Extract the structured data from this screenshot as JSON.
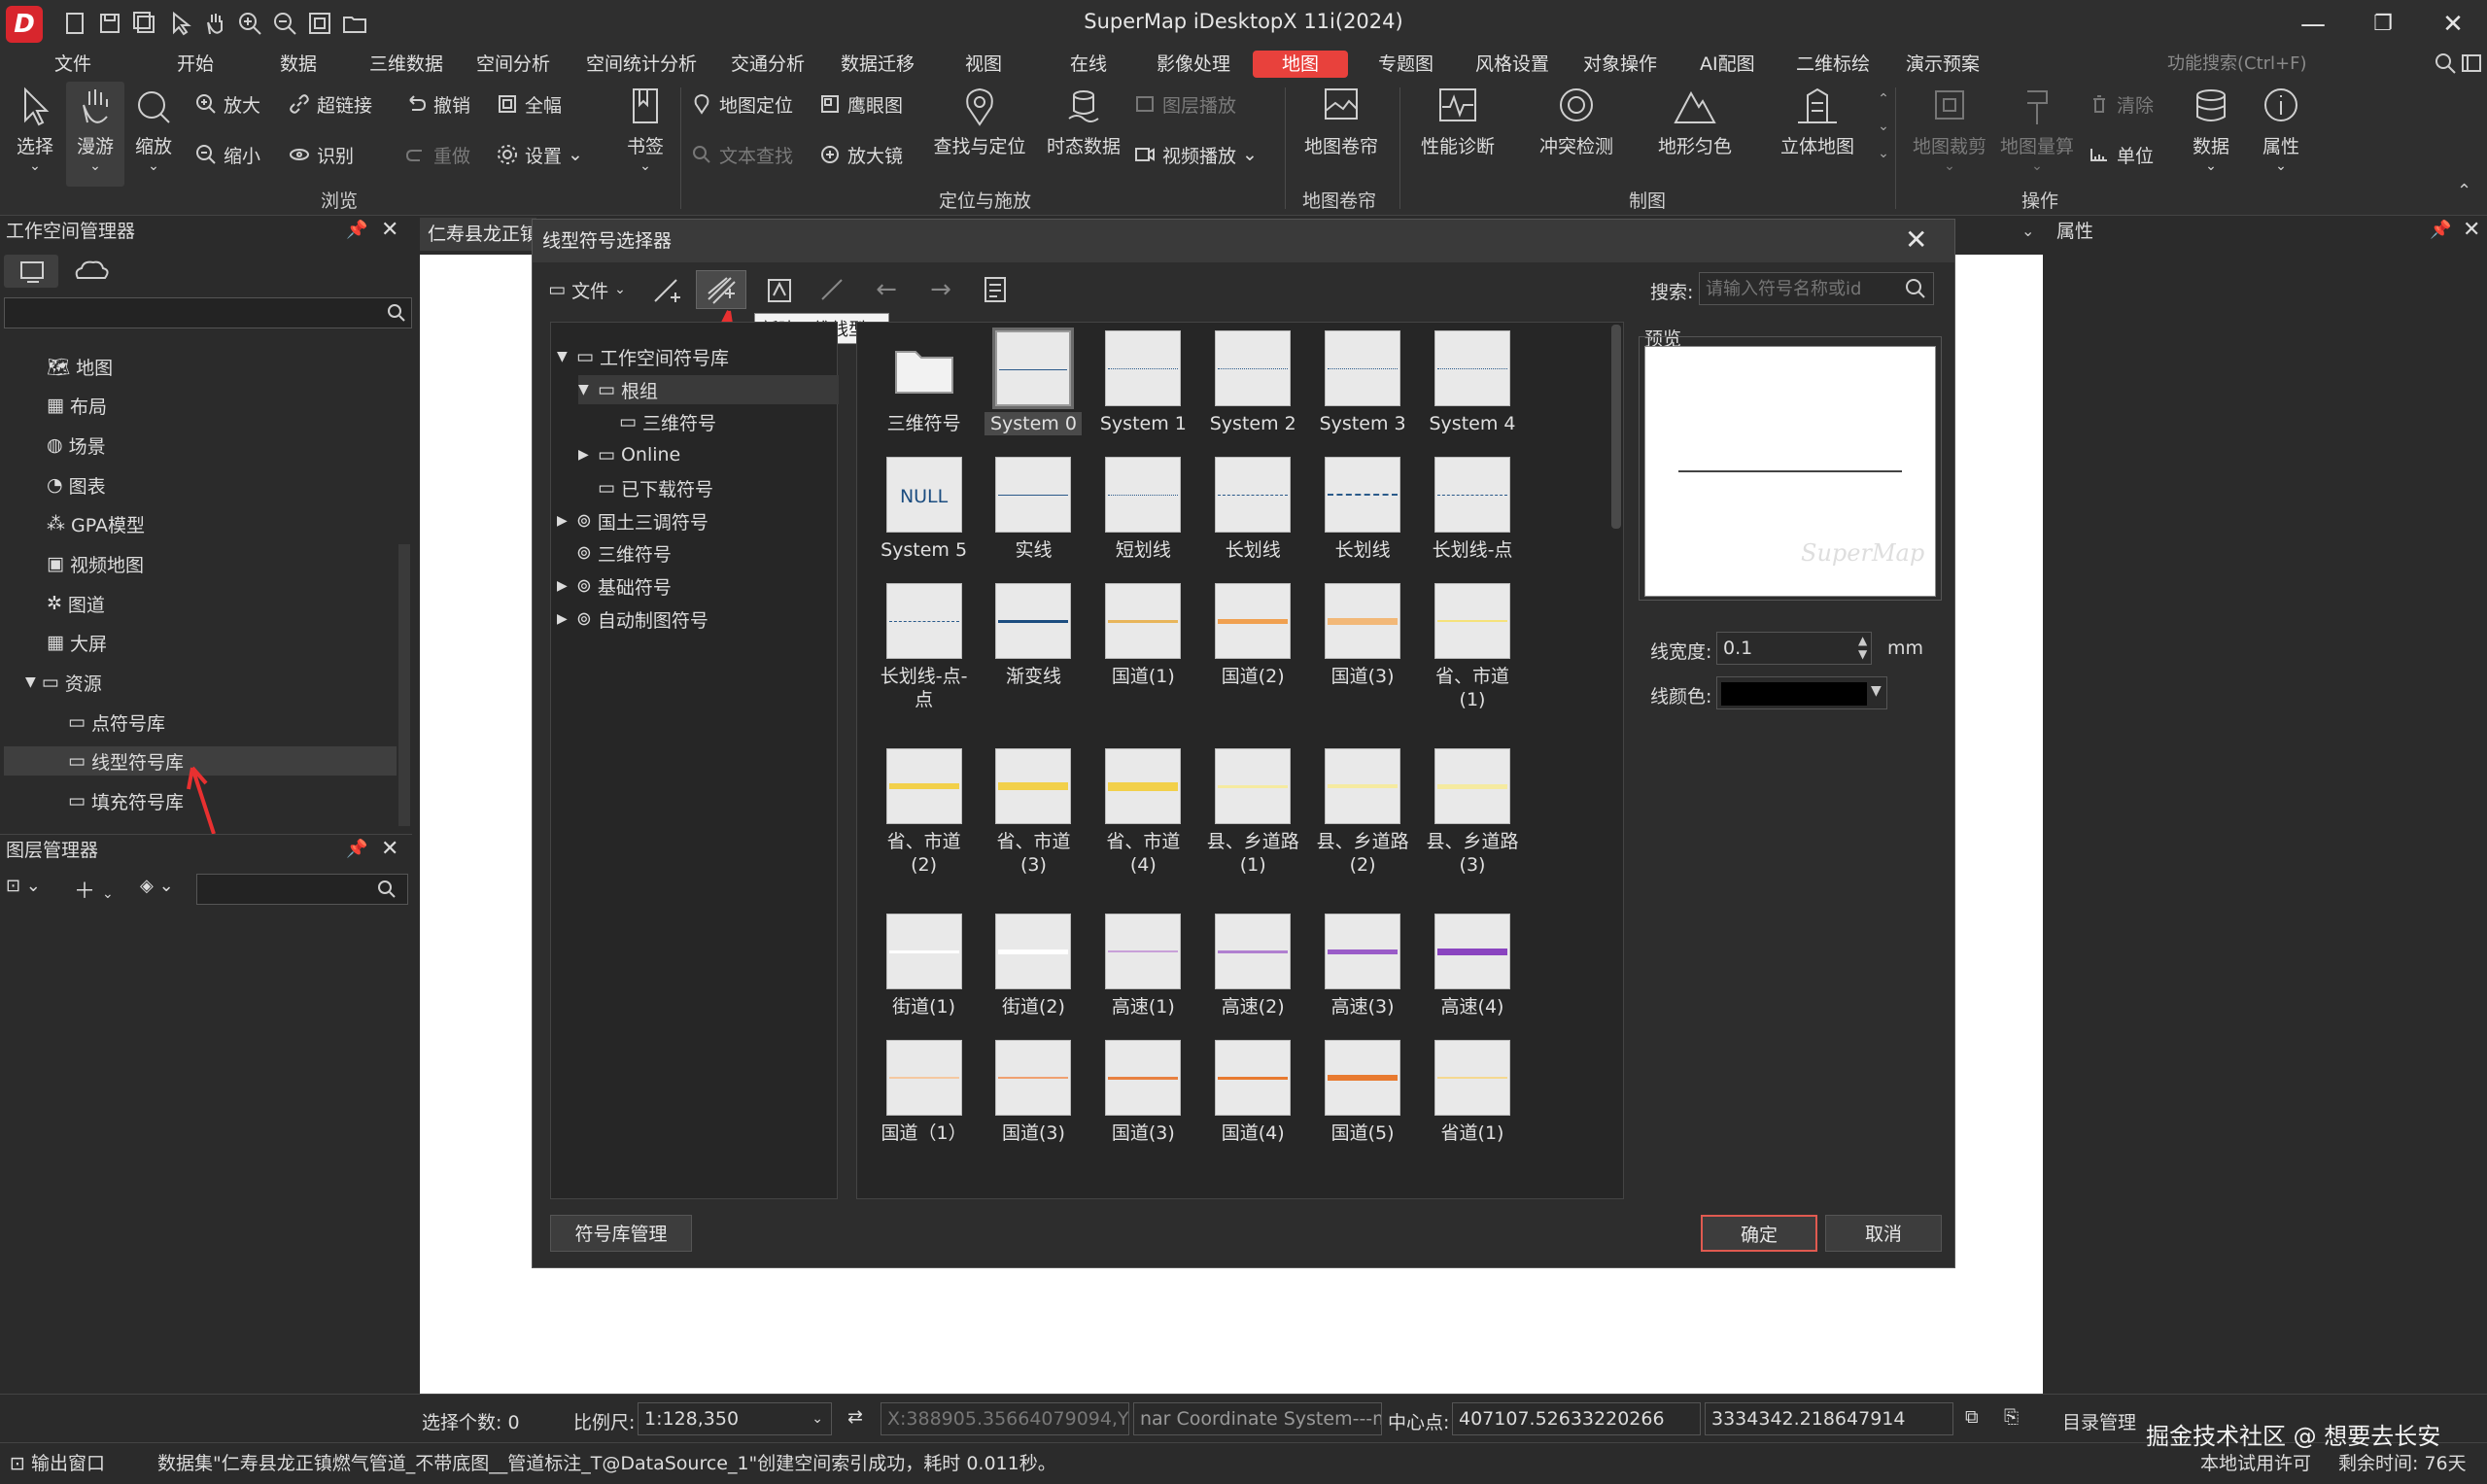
{
  "window": {
    "title": "SuperMap iDesktopX 11i(2024)",
    "minimize": "—",
    "restore": "❐",
    "close": "✕"
  },
  "menu": [
    "文件",
    "开始",
    "数据",
    "三维数据",
    "空间分析",
    "空间统计分析",
    "交通分析",
    "数据迁移",
    "视图",
    "在线",
    "影像处理",
    "地图",
    "专题图",
    "风格设置",
    "对象操作",
    "AI配图",
    "二维标绘",
    "演示预案"
  ],
  "menu_active": "地图",
  "feature_search": "功能搜索(Ctrl+F)",
  "ribbon": {
    "browse": {
      "select": "选择",
      "pan": "漫游",
      "zoom": "缩放",
      "zoom_in": "放大",
      "zoom_out": "缩小",
      "hyperlink": "超链接",
      "identify": "识别",
      "undo": "撤销",
      "redo": "重做",
      "full_extent": "全幅",
      "settings": "设置",
      "bookmark": "书签",
      "label": "浏览"
    },
    "locate": {
      "map_locate": "地图定位",
      "text_find": "文本查找",
      "hawkeye": "鹰眼图",
      "magnifier": "放大镜",
      "find_locate": "查找与定位",
      "temporal": "时态数据",
      "layer_play": "图层播放",
      "video_play": "视频播放",
      "label": "定位与施放"
    },
    "map_roll": {
      "item": "地图卷帘",
      "label": "地图卷帘"
    },
    "mapping": {
      "perf": "性能诊断",
      "conflict": "冲突检测",
      "terrain": "地形匀色",
      "stereo": "立体地图",
      "label": "制图"
    },
    "ops": {
      "clip": "地图裁剪",
      "measure": "地图量算",
      "clear": "清除",
      "unit": "单位",
      "data": "数据",
      "props": "属性",
      "label": "操作"
    }
  },
  "workspace_panel": {
    "title": "工作空间管理器",
    "items": [
      "地图",
      "布局",
      "场景",
      "图表",
      "GPA模型",
      "视频地图",
      "图道",
      "大屏",
      "资源",
      "点符号库",
      "线型符号库",
      "填充符号库"
    ],
    "selected": "线型符号库"
  },
  "layer_panel": {
    "title": "图层管理器"
  },
  "doc_tab": "仁寿县龙正镇",
  "dialog": {
    "title": "线型符号选择器",
    "file_menu": "文件",
    "tooltip": "新建三维线型...",
    "search_label": "搜索:",
    "search_placeholder": "请输入符号名称或id",
    "tree": [
      {
        "label": "工作空间符号库",
        "level": 0,
        "arrow": "▼"
      },
      {
        "label": "根组",
        "level": 1,
        "arrow": "▼"
      },
      {
        "label": "三维符号",
        "level": 2,
        "arrow": ""
      },
      {
        "label": "Online",
        "level": 1,
        "arrow": "▶"
      },
      {
        "label": "已下载符号",
        "level": 1,
        "arrow": ""
      },
      {
        "label": "国土三调符号",
        "level": 0,
        "arrow": "▶"
      },
      {
        "label": "三维符号",
        "level": 0,
        "arrow": ""
      },
      {
        "label": "基础符号",
        "level": 0,
        "arrow": "▶"
      },
      {
        "label": "自动制图符号",
        "level": 0,
        "arrow": "▶"
      }
    ],
    "symbols": [
      {
        "name": "三维符号",
        "kind": "folder"
      },
      {
        "name": "System 0",
        "color": "#2a5a8a",
        "h": 1,
        "style": "solid",
        "selected": true
      },
      {
        "name": "System 1",
        "color": "#2a5a8a",
        "h": 1,
        "style": "dotted"
      },
      {
        "name": "System 2",
        "color": "#2a5a8a",
        "h": 1,
        "style": "dotted"
      },
      {
        "name": "System 3",
        "color": "#2a5a8a",
        "h": 1,
        "style": "dotted"
      },
      {
        "name": "System 4",
        "color": "#2a5a8a",
        "h": 1,
        "style": "dotted"
      },
      {
        "name": "System 5",
        "kind": "null",
        "text": "NULL"
      },
      {
        "name": "实线",
        "color": "#2a5a8a",
        "h": 1,
        "style": "solid"
      },
      {
        "name": "短划线",
        "color": "#2a5a8a",
        "h": 1,
        "style": "dotted"
      },
      {
        "name": "长划线",
        "color": "#2a5a8a",
        "h": 1,
        "style": "dashed"
      },
      {
        "name": "长划线",
        "color": "#2a5a8a",
        "h": 2,
        "style": "dashed"
      },
      {
        "name": "长划线-点",
        "color": "#2a5a8a",
        "h": 1,
        "style": "dashed"
      },
      {
        "name": "长划线-点-点",
        "color": "#2a5a8a",
        "h": 1,
        "style": "dashed"
      },
      {
        "name": "渐变线",
        "color": "#1c4d80",
        "h": 3,
        "style": "solid"
      },
      {
        "name": "国道(1)",
        "color": "#e8b55a",
        "h": 3,
        "style": "solid"
      },
      {
        "name": "国道(2)",
        "color": "#f0a050",
        "h": 5,
        "style": "solid"
      },
      {
        "name": "国道(3)",
        "color": "#f2b878",
        "h": 7,
        "style": "solid"
      },
      {
        "name": "省、市道(1)",
        "color": "#f5e27a",
        "h": 2,
        "style": "solid"
      },
      {
        "name": "省、市道(2)",
        "color": "#f2d04a",
        "h": 6,
        "style": "solid"
      },
      {
        "name": "省、市道(3)",
        "color": "#f2d04a",
        "h": 8,
        "style": "solid"
      },
      {
        "name": "省、市道(4)",
        "color": "#f2d04a",
        "h": 9,
        "style": "solid"
      },
      {
        "name": "县、乡道路(1)",
        "color": "#f5eaa0",
        "h": 3,
        "style": "solid"
      },
      {
        "name": "县、乡道路(2)",
        "color": "#f5eaa0",
        "h": 4,
        "style": "solid"
      },
      {
        "name": "县、乡道路(3)",
        "color": "#f5eaa0",
        "h": 5,
        "style": "solid"
      },
      {
        "name": "街道(1)",
        "color": "#ffffff",
        "h": 3,
        "style": "solid"
      },
      {
        "name": "街道(2)",
        "color": "#ffffff",
        "h": 5,
        "style": "solid"
      },
      {
        "name": "高速(1)",
        "color": "#c8a0d8",
        "h": 2,
        "style": "solid"
      },
      {
        "name": "高速(2)",
        "color": "#b080d0",
        "h": 3,
        "style": "solid"
      },
      {
        "name": "高速(3)",
        "color": "#9a5cc8",
        "h": 5,
        "style": "solid"
      },
      {
        "name": "高速(4)",
        "color": "#8a44c0",
        "h": 7,
        "style": "solid"
      },
      {
        "name": "国道（1）",
        "color": "#f5c8a0",
        "h": 2,
        "style": "solid"
      },
      {
        "name": "国道(3)",
        "color": "#f0a070",
        "h": 2,
        "style": "solid"
      },
      {
        "name": "国道(3)",
        "color": "#e88040",
        "h": 3,
        "style": "solid"
      },
      {
        "name": "国道(4)",
        "color": "#e87a30",
        "h": 3,
        "style": "solid"
      },
      {
        "name": "国道(5)",
        "color": "#e87a30",
        "h": 6,
        "style": "solid"
      },
      {
        "name": "省道(1)",
        "color": "#f5d890",
        "h": 2,
        "style": "solid"
      }
    ],
    "preview_label": "预览",
    "watermark": "SuperMap",
    "line_width_label": "线宽度:",
    "line_width": "0.1",
    "unit": "mm",
    "line_color_label": "线颜色:",
    "line_color": "#000000",
    "manage_button": "符号库管理",
    "ok_button": "确定",
    "cancel_button": "取消"
  },
  "properties_panel": {
    "title": "属性"
  },
  "status": {
    "select_count": "选择个数: 0",
    "scale_label": "比例尺:",
    "scale": "1:128,350",
    "coords": "X:388905.35664079094,Y:3",
    "crs": "nar Coordinate System---m",
    "center_label": "中心点:",
    "center_x": "407107.52633220266",
    "center_y": "3334342.218647914",
    "catalog": "目录管理"
  },
  "bottom": {
    "output": "输出窗口",
    "message": "数据集\"仁寿县龙正镇燃气管道_不带底图__管道标注_T@DataSource_1\"创建空间索引成功，耗时 0.011秒。",
    "license": "本地试用许可",
    "days_left": "剩余时间: 76天",
    "watermark": "掘金技术社区 @ 想要去长安"
  }
}
